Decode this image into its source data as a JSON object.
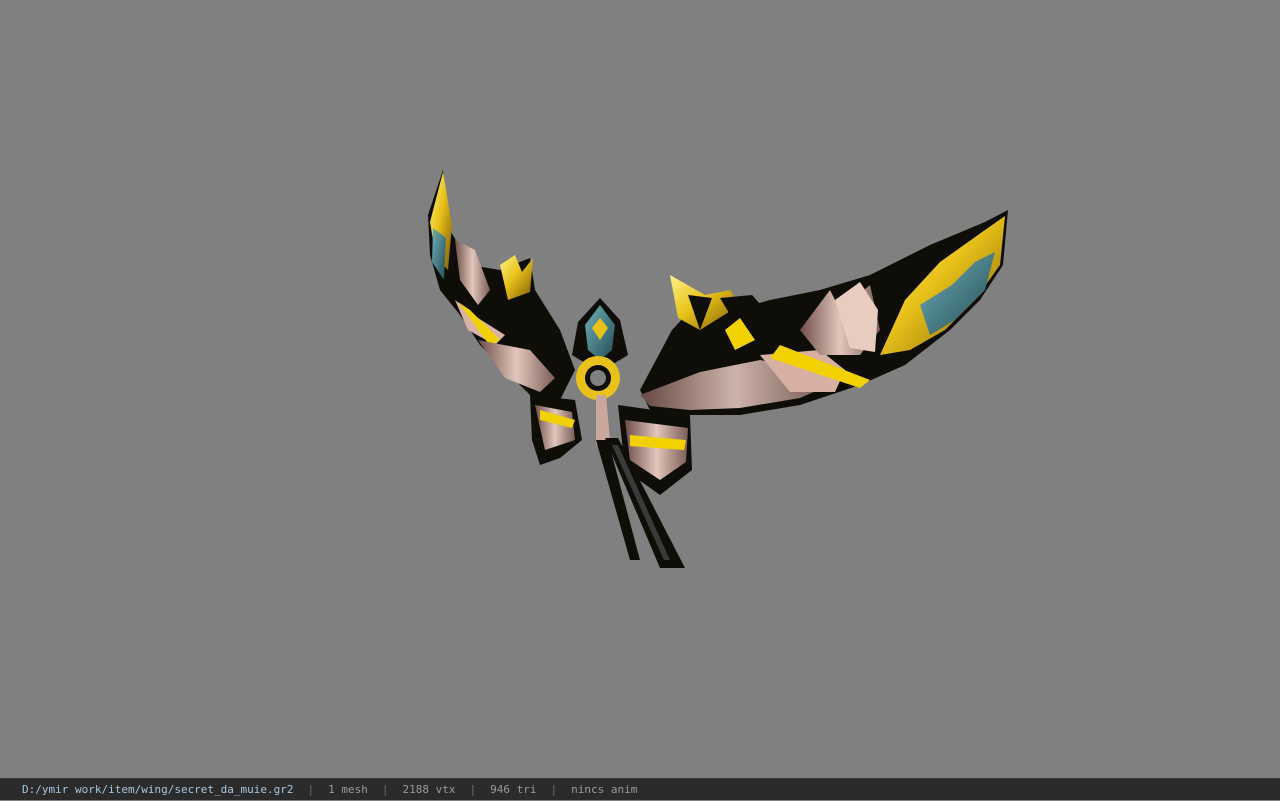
{
  "viewport": {
    "background": "#808080",
    "model_name": "secret_da_muie.gr2"
  },
  "status_bar": {
    "file_path": "D:/ymir work/item/wing/secret_da_muie.gr2",
    "separator": "|",
    "mesh_count": "1 mesh",
    "vertex_count": "2188 vtx",
    "triangle_count": "946 tri",
    "animation": "nincs anim"
  },
  "colors": {
    "gold": "#e8c21a",
    "dark": "#0f0d08",
    "pink": "#c9a79a",
    "teal": "#3e7a86",
    "statusbar_bg": "#2b2b2b",
    "path_text": "#a8c6e0"
  }
}
